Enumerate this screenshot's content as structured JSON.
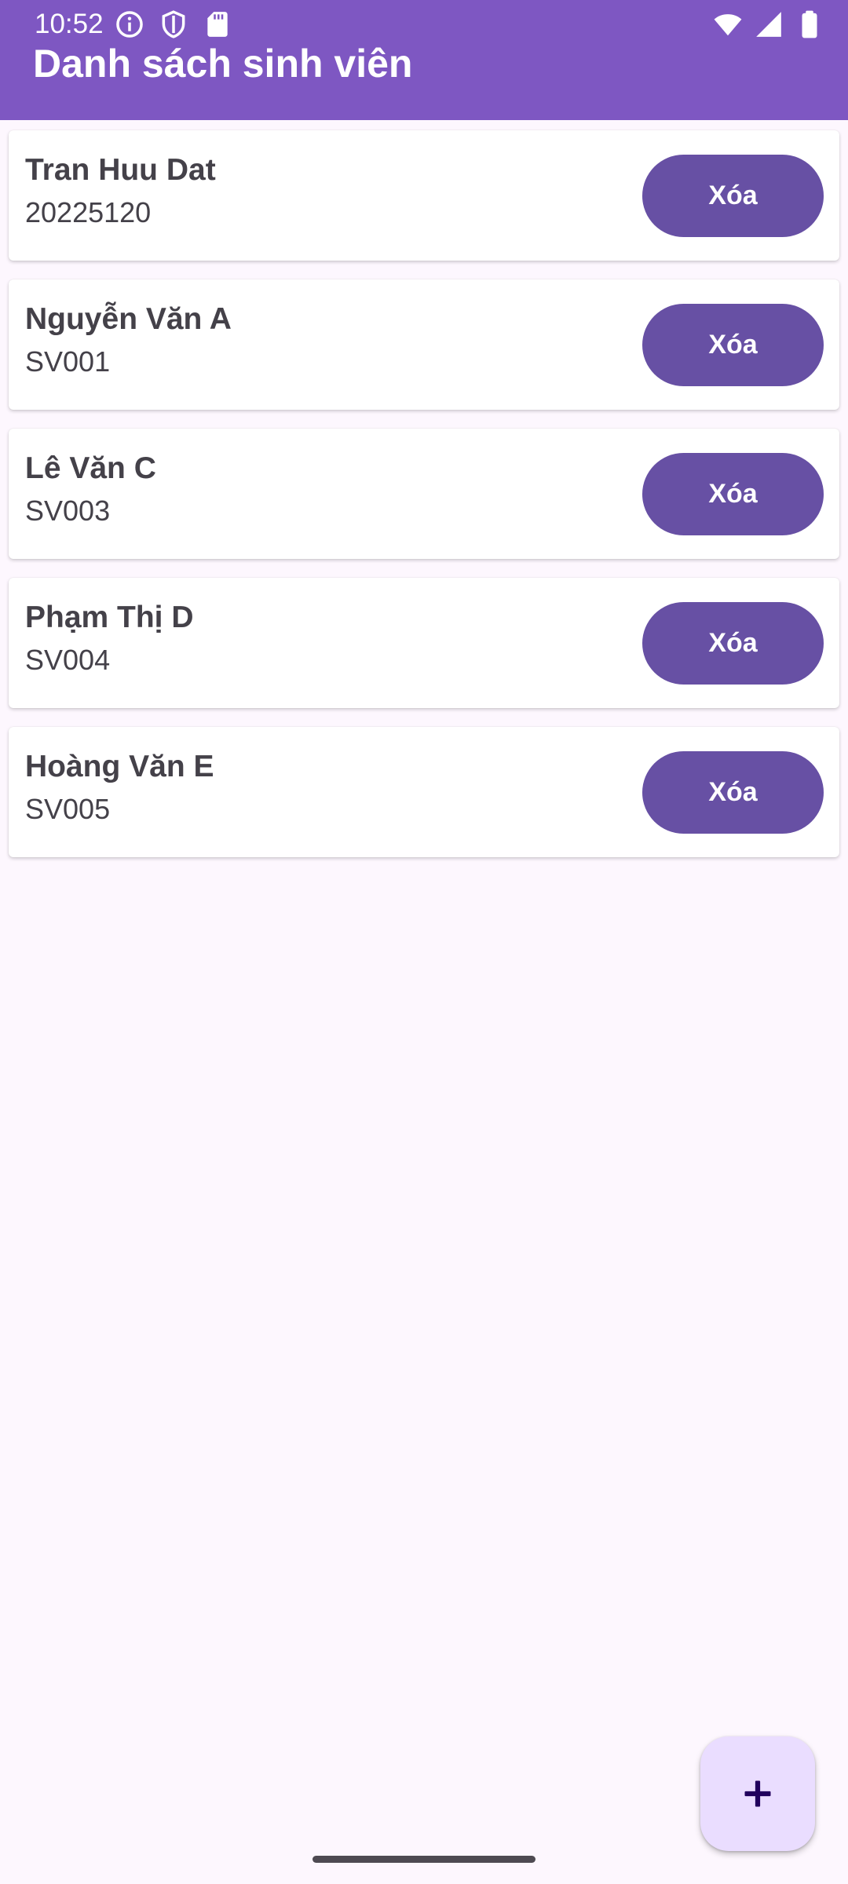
{
  "status_bar": {
    "time": "10:52",
    "icons": [
      "info-icon",
      "shield-icon",
      "sd-card-icon",
      "wifi-icon",
      "signal-icon",
      "battery-icon"
    ]
  },
  "app_bar": {
    "title": "Danh sách sinh viên",
    "background_color": "#7E57C2"
  },
  "students": [
    {
      "name": "Tran Huu Dat",
      "id": "20225120",
      "delete_label": "Xóa"
    },
    {
      "name": "Nguyễn Văn A",
      "id": "SV001",
      "delete_label": "Xóa"
    },
    {
      "name": "Lê Văn C",
      "id": "SV003",
      "delete_label": "Xóa"
    },
    {
      "name": "Phạm Thị D",
      "id": "SV004",
      "delete_label": "Xóa"
    },
    {
      "name": "Hoàng Văn E",
      "id": "SV005",
      "delete_label": "Xóa"
    }
  ],
  "fab": {
    "icon": "add-icon",
    "background_color": "#EADDFF"
  },
  "colors": {
    "button": "#6750A4",
    "page_background": "#FDF7FE"
  }
}
